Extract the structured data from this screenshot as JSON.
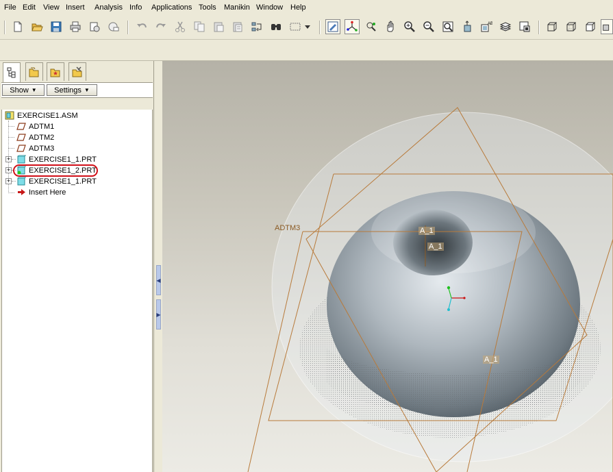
{
  "menu": {
    "items": [
      "File",
      "Edit",
      "View",
      "Insert",
      "Analysis",
      "Info",
      "Applications",
      "Tools",
      "Manikin",
      "Window",
      "Help"
    ]
  },
  "toolbar": {
    "icons": [
      "new-icon",
      "open-icon",
      "save-icon",
      "print-icon",
      "send-icon",
      "email-icon",
      "undo-icon",
      "redo-icon",
      "cut-icon",
      "copy-icon",
      "paste-icon",
      "paste-special-icon",
      "regenerate-icon",
      "find-icon",
      "select-box-icon",
      "dropdown-icon",
      "repaint-icon",
      "spin-center-icon",
      "orient-mode-icon",
      "pan-icon",
      "zoom-in-icon",
      "zoom-out-icon",
      "refit-icon",
      "reorient-icon",
      "saved-views-icon",
      "layers-icon",
      "view-manager-icon",
      "wireframe-icon",
      "hidden-line-icon",
      "no-hidden-icon",
      "shading-icon"
    ]
  },
  "model_tree": {
    "tabs": [
      "model-tree-tab",
      "folder-browser-tab",
      "favorites-tab",
      "connections-tab"
    ],
    "show_label": "Show",
    "settings_label": "Settings",
    "root": "EXERCISE1.ASM",
    "items": [
      {
        "label": "ADTM1",
        "type": "datum-plane"
      },
      {
        "label": "ADTM2",
        "type": "datum-plane"
      },
      {
        "label": "ADTM3",
        "type": "datum-plane"
      },
      {
        "label": "EXERCISE1_1.PRT",
        "type": "part"
      },
      {
        "label": "EXERCISE1_2.PRT",
        "type": "part",
        "selected": true
      },
      {
        "label": "EXERCISE1_1.PRT",
        "type": "part"
      },
      {
        "label": "Insert Here",
        "type": "insert"
      }
    ]
  },
  "graphics": {
    "datum_label": "ADTM3",
    "axis_tags": [
      "A_1",
      "A_1",
      "A_1"
    ],
    "colors": {
      "datum_plane": "#b87a3a",
      "highlight": "#d10f18",
      "part": "#9ba6ad"
    }
  }
}
